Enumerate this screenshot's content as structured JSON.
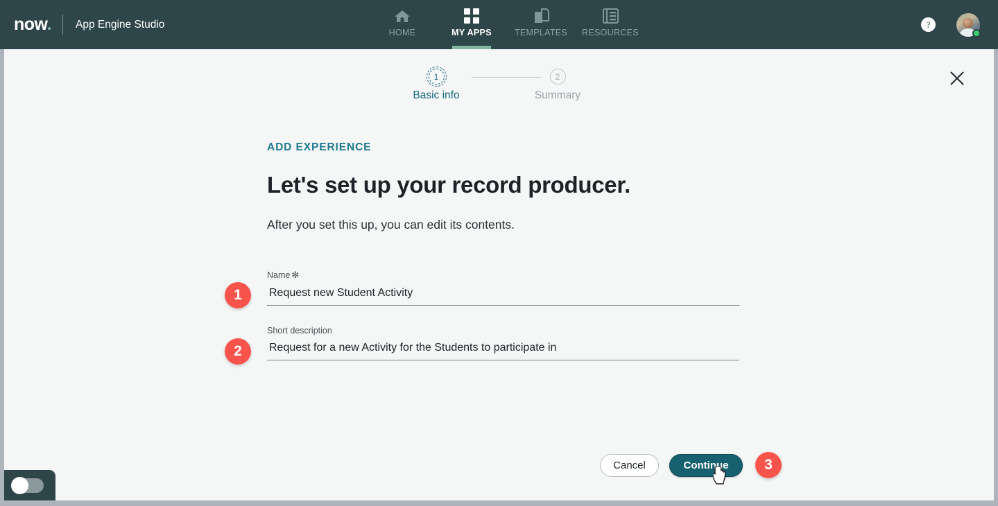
{
  "topbar": {
    "logo_text": "now",
    "app_title": "App Engine Studio",
    "help_glyph": "?",
    "tabs": [
      {
        "label": "HOME",
        "icon": "home-icon",
        "active": false
      },
      {
        "label": "MY APPS",
        "icon": "grid-icon",
        "active": true
      },
      {
        "label": "TEMPLATES",
        "icon": "templates-icon",
        "active": false
      },
      {
        "label": "RESOURCES",
        "icon": "resources-icon",
        "active": false
      }
    ]
  },
  "stepper": {
    "steps": [
      {
        "number": "1",
        "label": "Basic info",
        "state": "current"
      },
      {
        "number": "2",
        "label": "Summary",
        "state": "upcoming"
      }
    ]
  },
  "modal": {
    "close_icon": "close-icon",
    "eyebrow": "ADD EXPERIENCE",
    "headline": "Let's set up your record producer.",
    "subhead": "After you set this up, you can edit its contents."
  },
  "form": {
    "fields": [
      {
        "label": "Name",
        "required_marker": "✻",
        "value": "Request new Student Activity",
        "placeholder": "",
        "badge": "1"
      },
      {
        "label": "Short description",
        "required_marker": "",
        "value": "Request for a new Activity for the Students to participate in",
        "placeholder": "",
        "badge": "2"
      }
    ]
  },
  "actions": {
    "cancel_label": "Cancel",
    "continue_label": "Continue",
    "continue_badge": "3"
  },
  "colors": {
    "header_bg": "#2e4549",
    "accent_teal": "#16606f",
    "eyebrow_teal": "#1e7a90",
    "badge_red": "#f9544b",
    "active_underline": "#84b5a2",
    "presence_green": "#3ecf6e",
    "canvas_bg": "#f5f6f6",
    "frame_gray": "#aeb4bb"
  }
}
